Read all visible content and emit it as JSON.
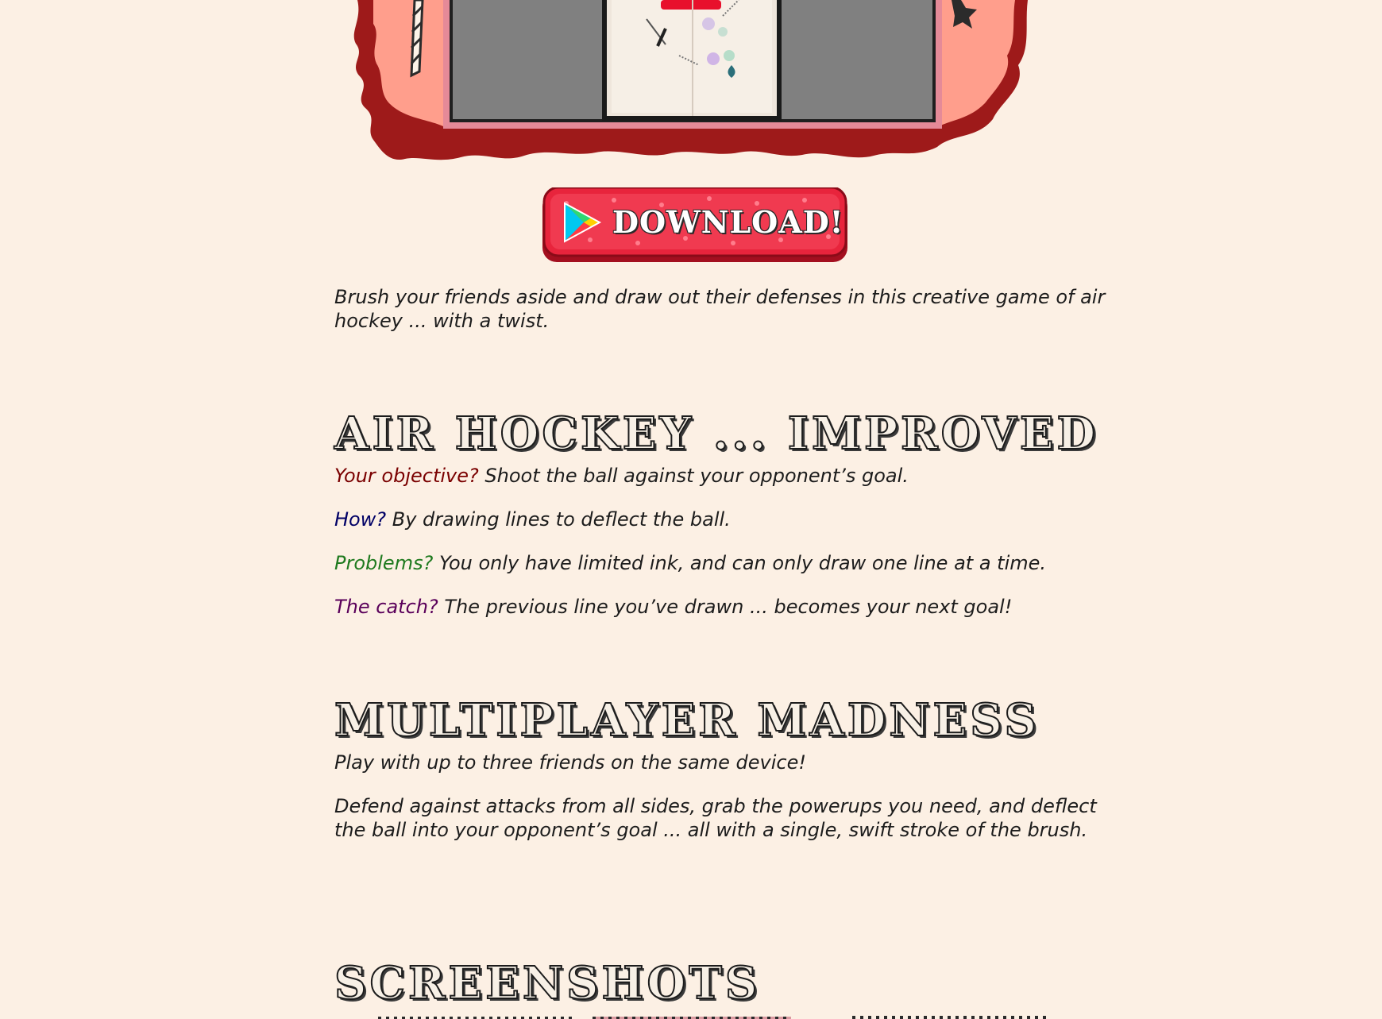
{
  "hero": {
    "alt": "Game preview"
  },
  "download": {
    "label": "DOWNLOAD!"
  },
  "intro": {
    "line1": "Brush your friends aside and draw out their defenses in this creative game of air",
    "line2": "hockey ... with a twist."
  },
  "section1": {
    "heading": "AIR HOCKEY ... IMPROVED",
    "items": [
      {
        "key": "Your objective?",
        "text": " Shoot the ball against your opponent’s goal.",
        "color": "#7a0000"
      },
      {
        "key": "How?",
        "text": " By drawing lines to deflect the ball.",
        "color": "#000066"
      },
      {
        "key": "Problems?",
        "text": " You only have limited ink, and can only draw one line at a time.",
        "color": "#1f7a1f"
      },
      {
        "key": "The catch?",
        "text": " The previous line you’ve drawn ... becomes your next goal!",
        "color": "#5a005a"
      }
    ]
  },
  "section2": {
    "heading": "MULTIPLAYER MADNESS",
    "p1": "Play with up to three friends on the same device!",
    "p2_line1": "Defend against attacks from all sides, grab the powerups you need, and deflect",
    "p2_line2": "the ball into your opponent’s goal ... all with a single, swift stroke of the brush."
  },
  "section3": {
    "heading": "SCREENSHOTS"
  },
  "colors": {
    "background": "#fcf0e4",
    "splash_dark": "#9e1a1a",
    "splash_light": "#ff9e8c",
    "button_red": "#e8243c",
    "text": "#1c1c1c"
  }
}
